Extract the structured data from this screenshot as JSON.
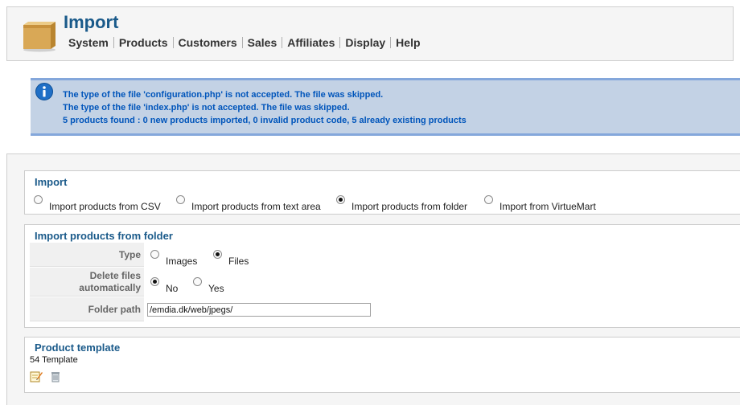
{
  "header": {
    "title": "Import",
    "icon": "package-box-icon",
    "menu": [
      "System",
      "Products",
      "Customers",
      "Sales",
      "Affiliates",
      "Display",
      "Help"
    ]
  },
  "messages": [
    "The type of the file 'configuration.php' is not accepted. The file was skipped.",
    "The type of the file 'index.php' is not accepted. The file was skipped.",
    "5 products found : 0 new products imported, 0 invalid product code, 5 already existing products"
  ],
  "import_section": {
    "legend": "Import",
    "options": [
      {
        "label": "Import products from CSV",
        "checked": false
      },
      {
        "label": "Import products from text area",
        "checked": false
      },
      {
        "label": "Import products from folder",
        "checked": true
      },
      {
        "label": "Import from VirtueMart",
        "checked": false
      }
    ]
  },
  "folder_section": {
    "legend": "Import products from folder",
    "type_label": "Type",
    "type_options": [
      {
        "label": "Images",
        "checked": false
      },
      {
        "label": "Files",
        "checked": true
      }
    ],
    "delete_label_line1": "Delete files",
    "delete_label_line2": "automatically",
    "delete_options": [
      {
        "label": "No",
        "checked": true
      },
      {
        "label": "Yes",
        "checked": false
      }
    ],
    "folder_label": "Folder path",
    "folder_value": "/emdia.dk/web/jpegs/"
  },
  "template_section": {
    "legend": "Product template",
    "template_name": "54 Template"
  },
  "colors": {
    "accent": "#1a5a8a",
    "message_bg": "#c3d2e5",
    "message_text": "#0055bb"
  }
}
